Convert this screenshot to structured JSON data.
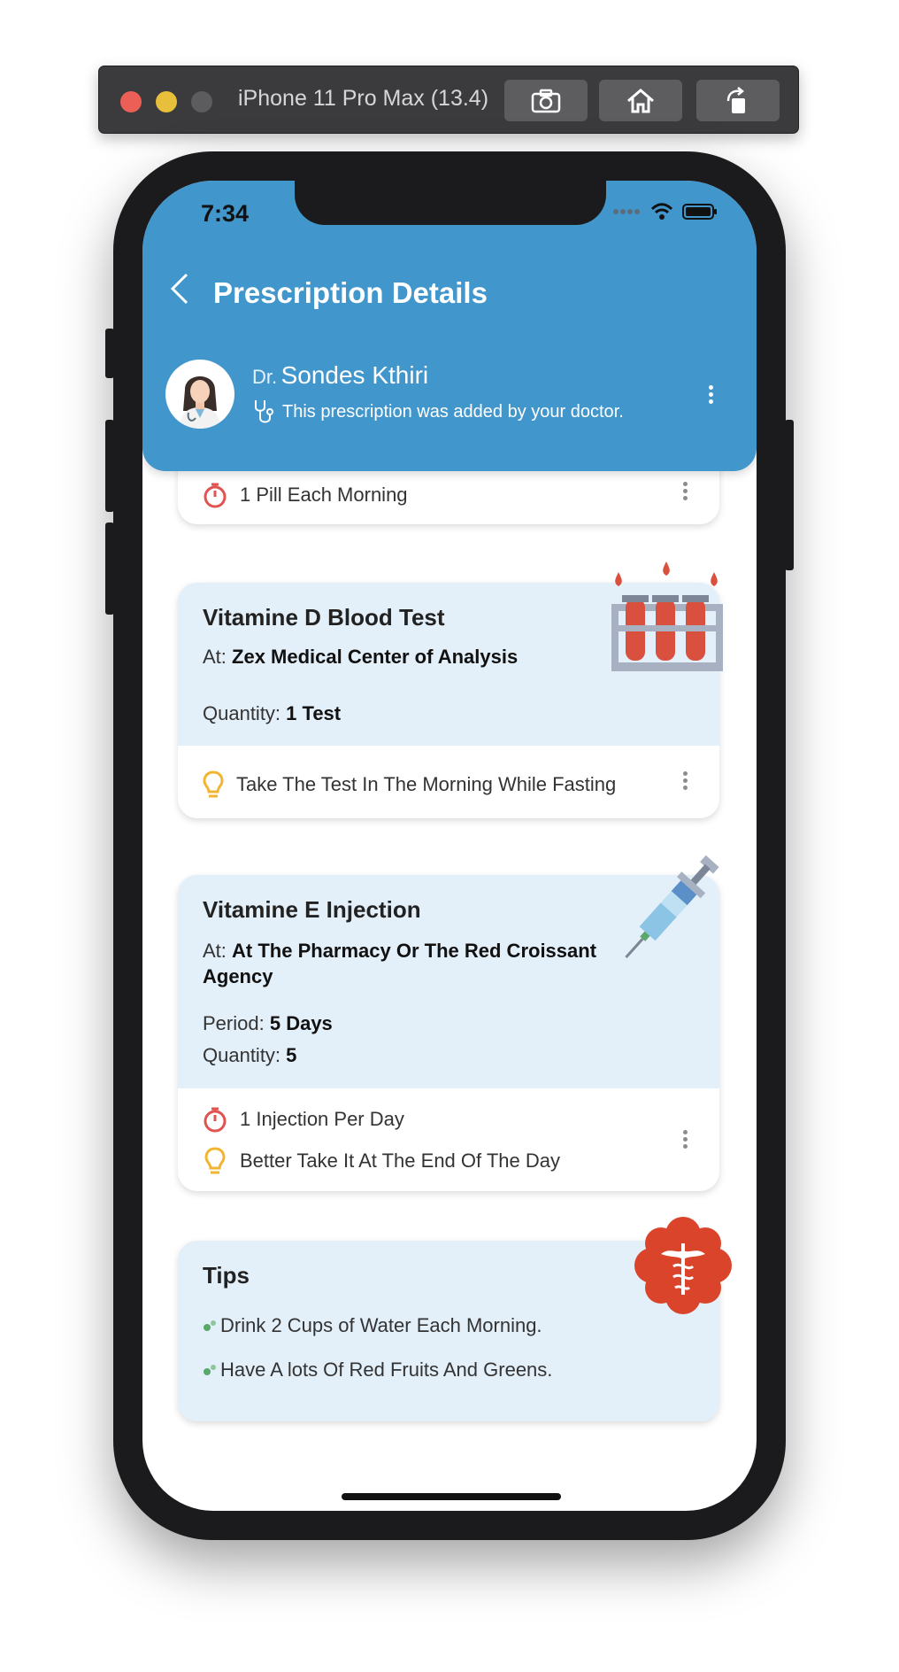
{
  "simulator": {
    "title": "iPhone 11 Pro Max (13.4)",
    "buttons": [
      "screenshot-icon",
      "home-icon",
      "rotate-icon"
    ]
  },
  "status_bar": {
    "time": "7:34"
  },
  "header": {
    "title": "Prescription Details",
    "doctor_prefix": "Dr.",
    "doctor_name": "Sondes Kthiri",
    "added_note": "This prescription was added by your doctor.",
    "color": "#4196cc"
  },
  "cards": {
    "partial": {
      "note": "1 Pill Each Morning"
    },
    "blood_test": {
      "title": "Vitamine D Blood Test",
      "at_label": "At:",
      "at_value": "Zex Medical Center of Analysis",
      "quantity_label": "Quantity:",
      "quantity_value": "1 Test",
      "tip": "Take The Test In The Morning While Fasting"
    },
    "injection": {
      "title": "Vitamine E Injection",
      "at_label": "At:",
      "at_value": "At The Pharmacy Or The Red Croissant Agency",
      "period_label": "Period:",
      "period_value": "5 Days",
      "quantity_label": "Quantity:",
      "quantity_value": "5",
      "schedule": "1 Injection Per Day",
      "tip": "Better Take It At The End Of The Day"
    },
    "tips": {
      "title": "Tips",
      "items": [
        "Drink 2 Cups of Water Each Morning.",
        "Have A lots Of Red Fruits And Greens."
      ]
    }
  },
  "colors": {
    "card_top": "#e3eff9",
    "timer_icon": "#e05350",
    "bulb_icon": "#f2b531",
    "bullet": "#5aa96b",
    "medical_badge": "#d9442b"
  }
}
